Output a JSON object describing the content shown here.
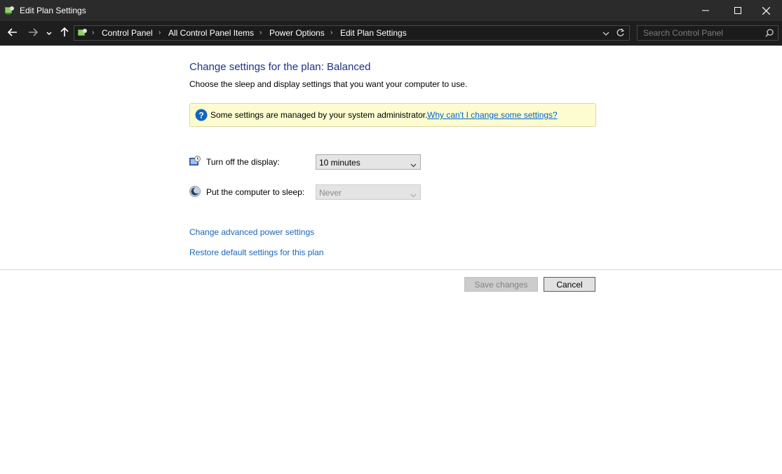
{
  "window": {
    "title": "Edit Plan Settings",
    "controls": {
      "minimize": "minimize-icon",
      "maximize": "maximize-icon",
      "close": "close-icon"
    }
  },
  "nav": {
    "back": "back-arrow-icon",
    "forward": "forward-arrow-icon",
    "recent": "chevron-down-icon",
    "up": "up-arrow-icon",
    "breadcrumbs": [
      "Control Panel",
      "All Control Panel Items",
      "Power Options",
      "Edit Plan Settings"
    ],
    "search_placeholder": "Search Control Panel"
  },
  "main": {
    "heading": "Change settings for the plan: Balanced",
    "subtitle": "Choose the sleep and display settings that you want your computer to use.",
    "notice": {
      "text": "Some settings are managed by your system administrator.",
      "link": "Why can't I change some settings?"
    },
    "settings": [
      {
        "label": "Turn off the display:",
        "value": "10 minutes",
        "enabled": true,
        "icon": "display-timer-icon"
      },
      {
        "label": "Put the computer to sleep:",
        "value": "Never",
        "enabled": false,
        "icon": "sleep-moon-icon"
      }
    ],
    "links": {
      "advanced": "Change advanced power settings",
      "restore": "Restore default settings for this plan"
    },
    "buttons": {
      "save": "Save changes",
      "cancel": "Cancel"
    }
  },
  "colors": {
    "titlebar": "#2b2b2b",
    "heading": "#1e3287",
    "link": "#1a65b8",
    "notice_bg": "#fcfcd0",
    "info_icon": "#1565c0"
  }
}
